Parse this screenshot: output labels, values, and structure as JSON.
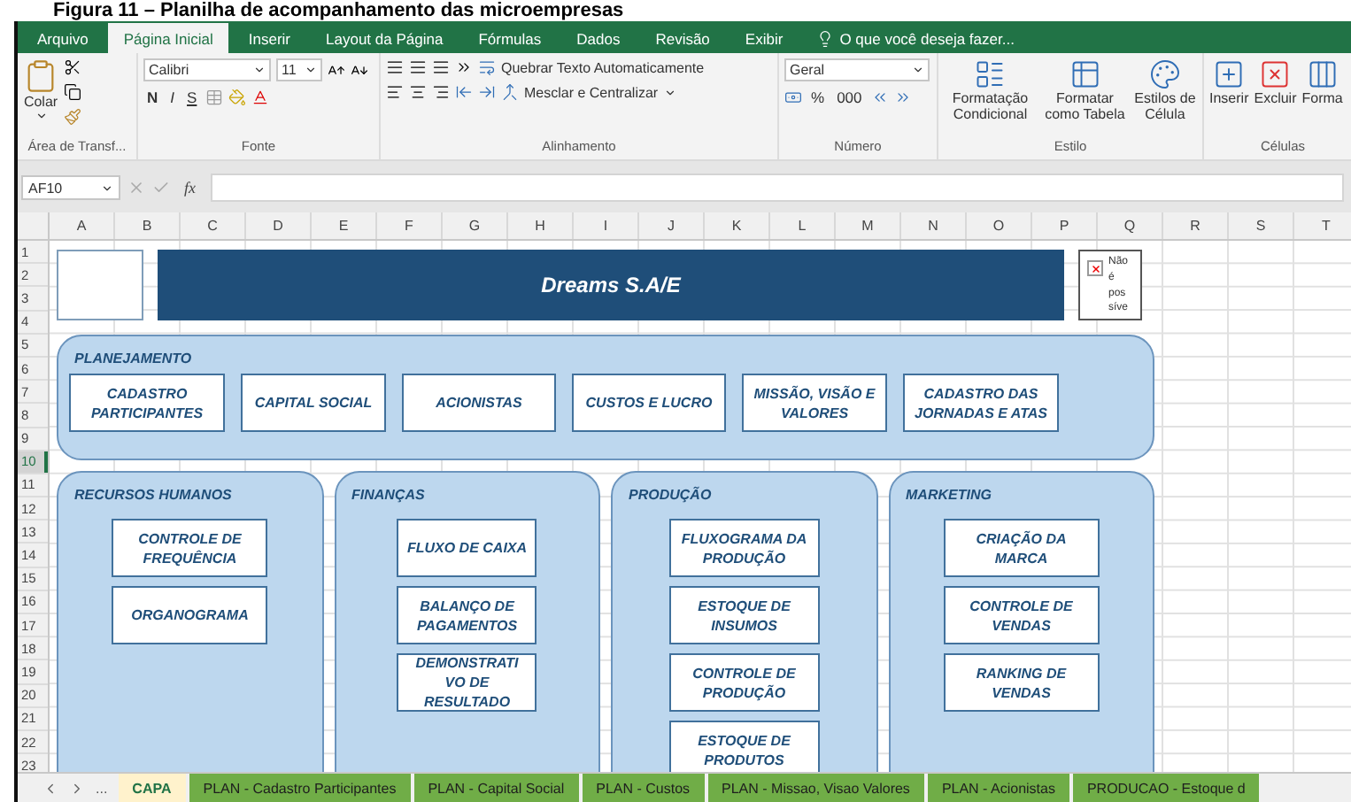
{
  "caption": "Figura 11 – Planilha de acompanhamento das microempresas",
  "ribbon_tabs": [
    {
      "label": "Arquivo",
      "selected": false
    },
    {
      "label": "Página Inicial",
      "selected": true
    },
    {
      "label": "Inserir",
      "selected": false
    },
    {
      "label": "Layout da Página",
      "selected": false
    },
    {
      "label": "Fórmulas",
      "selected": false
    },
    {
      "label": "Dados",
      "selected": false
    },
    {
      "label": "Revisão",
      "selected": false
    },
    {
      "label": "Exibir",
      "selected": false
    }
  ],
  "tell_me": "O que você deseja fazer...",
  "ribbon": {
    "clipboard": {
      "label": "Área de Transf...",
      "paste": "Colar"
    },
    "font": {
      "label": "Fonte",
      "name": "Calibri",
      "size": "11",
      "bold": "N",
      "italic": "I",
      "underline": "S"
    },
    "alignment": {
      "label": "Alinhamento",
      "wrap": "Quebrar Texto Automaticamente",
      "merge": "Mesclar e Centralizar"
    },
    "number": {
      "label": "Número",
      "format": "Geral",
      "percent": "%",
      "thousands": "000"
    },
    "styles": {
      "label": "Estilo",
      "buttons": [
        "Formatação Condicional",
        "Formatar como Tabela",
        "Estilos de Célula"
      ]
    },
    "cells": {
      "label": "Células",
      "buttons": [
        "Inserir",
        "Excluir",
        "Forma"
      ]
    }
  },
  "formula_bar": {
    "name_box": "AF10",
    "function_label": "fx"
  },
  "columns": [
    "A",
    "B",
    "C",
    "D",
    "E",
    "F",
    "G",
    "H",
    "I",
    "J",
    "K",
    "L",
    "M",
    "N",
    "O",
    "P",
    "Q",
    "R",
    "S",
    "T"
  ],
  "rows": [
    {
      "label": "1",
      "selected": false
    },
    {
      "label": "2",
      "selected": false
    },
    {
      "label": "3",
      "selected": false
    },
    {
      "label": "4",
      "selected": false
    },
    {
      "label": "5",
      "selected": false
    },
    {
      "label": "6",
      "selected": false
    },
    {
      "label": "7",
      "selected": false
    },
    {
      "label": "8",
      "selected": false
    },
    {
      "label": "9",
      "selected": false
    },
    {
      "label": "10",
      "selected": true
    },
    {
      "label": "11",
      "selected": false
    },
    {
      "label": "12",
      "selected": false
    },
    {
      "label": "13",
      "selected": false
    },
    {
      "label": "14",
      "selected": false
    },
    {
      "label": "15",
      "selected": false
    },
    {
      "label": "16",
      "selected": false
    },
    {
      "label": "17",
      "selected": false
    },
    {
      "label": "18",
      "selected": false
    },
    {
      "label": "19",
      "selected": false
    },
    {
      "label": "20",
      "selected": false
    },
    {
      "label": "21",
      "selected": false
    },
    {
      "label": "22",
      "selected": false
    },
    {
      "label": "23",
      "selected": false
    }
  ],
  "sheet": {
    "title": "Dreams S.A/E",
    "broken_image": [
      "Não",
      "é",
      "pos",
      "síve"
    ]
  },
  "sections": [
    {
      "kind": "wide",
      "title": "PLANEJAMENTO",
      "buttons": [
        "CADASTRO PARTICIPANTES",
        "CAPITAL SOCIAL",
        "ACIONISTAS",
        "CUSTOS E LUCRO",
        "MISSÃO, VISÃO E VALORES",
        "CADASTRO DAS JORNADAS E ATAS"
      ]
    },
    {
      "kind": "column",
      "title": "RECURSOS HUMANOS",
      "buttons": [
        "CONTROLE DE FREQUÊNCIA",
        "ORGANOGRAMA"
      ]
    },
    {
      "kind": "column",
      "title": "FINANÇAS",
      "buttons": [
        "FLUXO DE CAIXA",
        "BALANÇO DE PAGAMENTOS",
        "DEMONSTRATI VO DE RESULTADO"
      ]
    },
    {
      "kind": "column",
      "title": "PRODUÇÃO",
      "buttons": [
        "FLUXOGRAMA DA PRODUÇÃO",
        "ESTOQUE DE INSUMOS",
        "CONTROLE DE PRODUÇÃO",
        "ESTOQUE DE PRODUTOS"
      ]
    },
    {
      "kind": "column",
      "title": "MARKETING",
      "buttons": [
        "CRIAÇÃO DA MARCA",
        "CONTROLE DE VENDAS",
        "RANKING DE VENDAS"
      ]
    }
  ],
  "sheet_tabs_more": "...",
  "sheet_tabs": [
    {
      "label": "CAPA",
      "selected": true
    },
    {
      "label": "PLAN - Cadastro Participantes",
      "selected": false
    },
    {
      "label": "PLAN - Capital Social",
      "selected": false
    },
    {
      "label": "PLAN - Custos",
      "selected": false
    },
    {
      "label": "PLAN - Missao, Visao Valores",
      "selected": false
    },
    {
      "label": "PLAN - Acionistas",
      "selected": false
    },
    {
      "label": "PRODUCAO - Estoque d",
      "selected": false
    }
  ]
}
